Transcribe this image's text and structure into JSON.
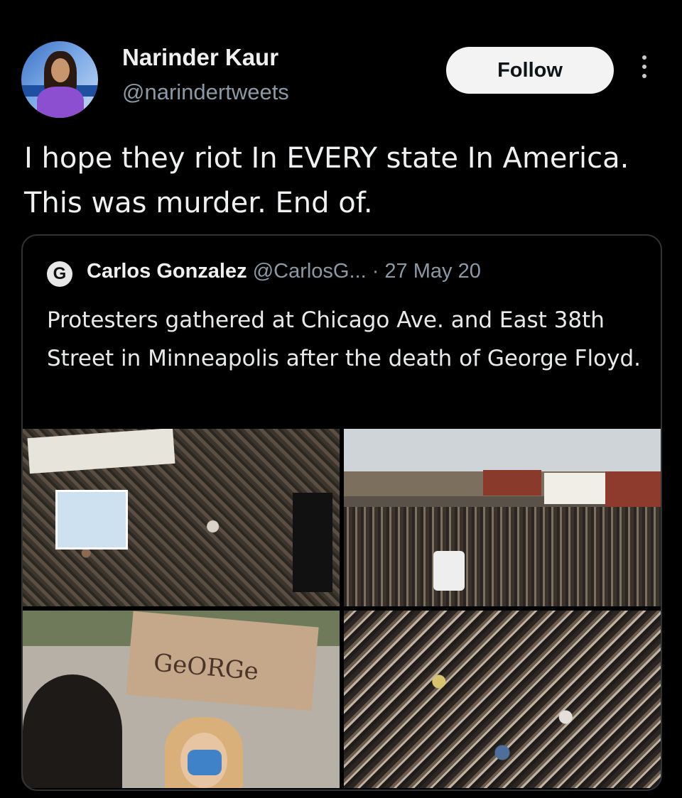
{
  "author": {
    "name": "Narinder Kaur",
    "handle": "@narindertweets"
  },
  "actions": {
    "follow_label": "Follow"
  },
  "tweet": {
    "text": "I hope they riot In EVERY state In America. This was murder. End of."
  },
  "quoted_tweet": {
    "logo_letter": "G",
    "name": "Carlos Gonzalez",
    "handle": "@CarlosG...",
    "date": "· 27 May 20",
    "text": "Protesters gathered at Chicago Ave. and East 38th Street in Minneapolis after the death of George Floyd.",
    "photo_sign_text": "GeORGe"
  },
  "colors": {
    "background": "#000000",
    "text": "#e7e9ea",
    "secondary_text": "#8b98a5",
    "follow_button_bg": "#f3f3f3",
    "border": "#2f3336"
  }
}
